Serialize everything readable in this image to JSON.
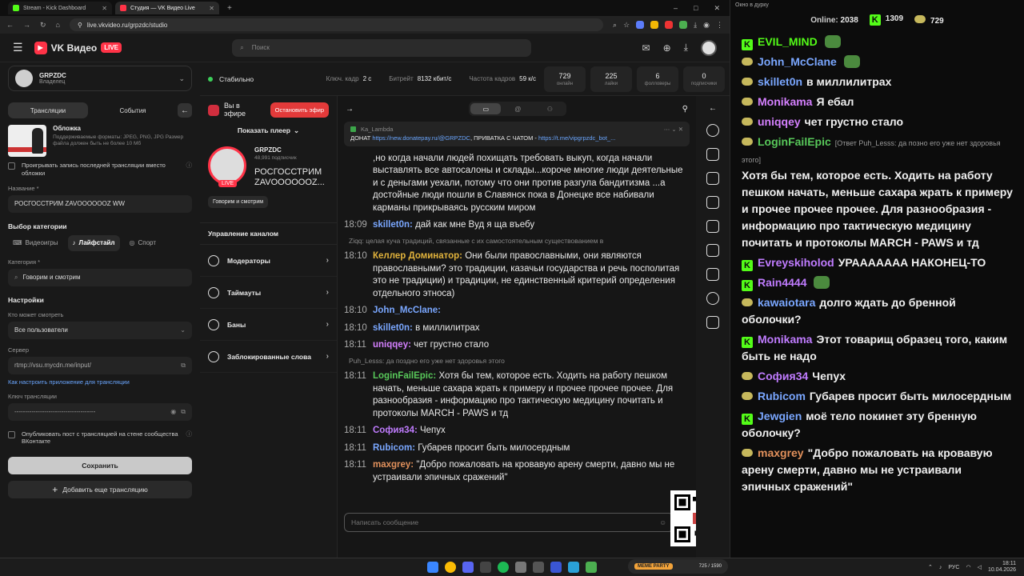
{
  "browser": {
    "tabs": [
      {
        "label": "Stream - Kick Dashboard",
        "active": false,
        "color": "#53fc18"
      },
      {
        "label": "Студия — VK Видео Live",
        "active": true,
        "color": "#ff3347"
      }
    ],
    "new_tab": "+",
    "url": "live.vkvideo.ru/grpzdc/studio"
  },
  "header": {
    "logo": "VK Видео",
    "live_badge": "LIVE",
    "search_placeholder": "Поиск"
  },
  "channel": {
    "name": "GRPZDC",
    "role": "Владелец"
  },
  "left": {
    "tab_streams": "Трансляции",
    "tab_events": "События",
    "cover_title": "Обложка",
    "cover_desc": "Поддерживаемые форматы: JPEG, PNG, JPG Размер файла должен быть не более 10 Мб",
    "replay_checkbox": "Проигрывать запись последней трансляции вместо обложки",
    "title_label": "Название *",
    "title_value": "РОСГОССТРИМ ZAVOOOOOOZ WW",
    "category_section": "Выбор категории",
    "cat_games": "Видеоигры",
    "cat_lifestyle": "Лайфстайл",
    "cat_sport": "Спорт",
    "category_label": "Категория *",
    "category_value": "Говорим и смотрим",
    "settings_section": "Настройки",
    "who_label": "Кто может смотреть",
    "who_value": "Все пользователи",
    "server_label": "Сервер",
    "server_value": "rtmp://vsu.mycdn.me/input/",
    "howto_link": "Как настроить приложение для трансляции",
    "key_label": "Ключ трансляции",
    "key_value": "--------------------------------------",
    "post_checkbox": "Опубликовать пост с трансляцией на стене сообщества ВКонтакте",
    "save_button": "Сохранить",
    "add_button": "Добавить еще трансляцию"
  },
  "stats": {
    "status": "Стабильно",
    "keyframe_label": "Ключ. кадр",
    "keyframe_value": "2 с",
    "bitrate_label": "Битрейт",
    "bitrate_value": "8132 кбит/с",
    "fps_label": "Частота кадров",
    "fps_value": "59 к/с",
    "online_value": "729",
    "online_label": "онлайн",
    "likes_value": "225",
    "likes_label": "лайки",
    "followers_value": "6",
    "followers_label": "фолловеры",
    "subs_value": "0",
    "subs_label": "подписчики"
  },
  "mid": {
    "on_air": "Вы в эфире",
    "stop_button": "Остановить эфир",
    "show_player": "Показать плеер",
    "streamer_name": "GRPZDC",
    "streamer_subs": "48,991 подписчик",
    "stream_title": "РОСГОССТРИМ ZAVOOOOOOZ...",
    "live_tag": "LIVE",
    "category_tag": "Говорим и смотрим",
    "manage_header": "Управление каналом",
    "manage_items": [
      "Модераторы",
      "Таймауты",
      "Баны",
      "Заблокированные слова"
    ]
  },
  "chat": {
    "pinned_author": "Ka_Lambda",
    "pinned_text": "ДОНАТ",
    "pinned_link1": "https://new.donatepay.ru/@GRPZDC",
    "pinned_mid": ", ПРИВАТКА С ЧАТОМ -",
    "pinned_link2": "https://t.me/vipgrpzdc_bot_...",
    "messages": [
      {
        "time": "",
        "name": "",
        "color": "#e8e8e8",
        "text": ",но когда начали людей похищать требовать выкуп, когда начали выставлять все автосалоны и склады...короче многие люди деятельные и с деньгами уехали, потому что они против разгула бандитизма ...а достойные люди пошли в Славянск пока в Донецке все набивали карманы прикрываясь русским миром",
        "reply": ""
      },
      {
        "time": "18:09",
        "name": "skillet0n:",
        "color": "#7aa7ff",
        "text": "дай как мне Вуд я ща въебу",
        "reply": ""
      },
      {
        "time": "18:10",
        "name": "Келлер Доминатор:",
        "color": "#e2b33c",
        "text": "Они были православными, они являются православными? это традиции, казачьи государства и речь посполитая это не традиции) и традиции, не единственный критерий определения отдельного этноса)",
        "reply": "Ziqq: целая куча традиций, связанные с их самостоятельным существованием в"
      },
      {
        "time": "18:10",
        "name": "John_McClane:",
        "color": "#7aa7ff",
        "text": "",
        "reply": ""
      },
      {
        "time": "18:10",
        "name": "skillet0n:",
        "color": "#7aa7ff",
        "text": "в миллилитрах",
        "reply": ""
      },
      {
        "time": "18:11",
        "name": "uniqqey:",
        "color": "#d580ff",
        "text": "чет грустно стало",
        "reply": ""
      },
      {
        "time": "18:11",
        "name": "LoginFailEpic:",
        "color": "#58c95a",
        "text": "Хотя бы тем, которое есть. Ходить на работу пешком начать, меньше сахара жрать к примеру и прочее прочее прочее. Для разнообразия - информацию про тактическую медицину почитать и протоколы MARCH - PAWS и тд",
        "reply": "Puh_Lesss: да поздно его уже нет здоровья этого"
      },
      {
        "time": "18:11",
        "name": "София34:",
        "color": "#c07cff",
        "text": "Чепух",
        "reply": ""
      },
      {
        "time": "18:11",
        "name": "Rubicom:",
        "color": "#7aa7ff",
        "text": "Губарев просит быть милосердным",
        "reply": ""
      },
      {
        "time": "18:11",
        "name": "maxgrey:",
        "color": "#e2915c",
        "text": "\"Добро пожаловать на кровавую арену смерти, давно мы не устраивали эпичных сражений\"",
        "reply": ""
      }
    ],
    "input_placeholder": "Написать сообщение"
  },
  "kick": {
    "window_title": "Окно в дурку",
    "online_label": "Online:",
    "online_value": "2038",
    "kick_count": "1309",
    "vk_count": "729",
    "messages": [
      {
        "badge": "k",
        "name": "EVIL_MIND",
        "color": "#53fc18",
        "text": "",
        "reply": ""
      },
      {
        "badge": "vk",
        "name": "John_McClane",
        "color": "#7aa7ff",
        "text": "",
        "reply": ""
      },
      {
        "badge": "vk",
        "name": "skillet0n",
        "color": "#7aa7ff",
        "text": "в миллилитрах",
        "reply": ""
      },
      {
        "badge": "vk",
        "name": "Monikama",
        "color": "#d580ff",
        "text": "Я ебал",
        "reply": ""
      },
      {
        "badge": "vk",
        "name": "uniqqey",
        "color": "#d580ff",
        "text": "чет грустно стало",
        "reply": ""
      },
      {
        "badge": "vk",
        "name": "LoginFailEpic",
        "color": "#58c95a",
        "text": "Хотя бы тем, которое есть. Ходить на работу пешком начать, меньше сахара жрать к примеру и прочее прочее прочее. Для разнообразия - информацию про тактическую медицину почитать и протоколы MARCH - PAWS и тд",
        "reply": "[Ответ Puh_Lesss: да позно его уже нет здоровья этого]"
      },
      {
        "badge": "k",
        "name": "Evreyskiholod",
        "color": "#c07cff",
        "text": "УРААААААА НАКОНЕЦ-ТО",
        "reply": ""
      },
      {
        "badge": "k",
        "name": "Rain4444",
        "color": "#c07cff",
        "text": "",
        "reply": ""
      },
      {
        "badge": "vk",
        "name": "kawaiotara",
        "color": "#7aa7ff",
        "text": "долго ждать до бренной оболочки?",
        "reply": ""
      },
      {
        "badge": "k",
        "name": "Monikama",
        "color": "#c07cff",
        "text": "Этот товарищ образец того, каким быть не надо",
        "reply": ""
      },
      {
        "badge": "vk",
        "name": "София34",
        "color": "#c07cff",
        "text": "Чепух",
        "reply": ""
      },
      {
        "badge": "vk",
        "name": "Rubicom",
        "color": "#7aa7ff",
        "text": "Губарев просит быть милосердным",
        "reply": ""
      },
      {
        "badge": "k",
        "name": "Jewgien",
        "color": "#7aa7ff",
        "text": "моё тело покинет эту бренную оболочку?",
        "reply": ""
      },
      {
        "badge": "vk",
        "name": "maxgrey",
        "color": "#e2915c",
        "text": "\"Добро пожаловать на кровавую арену смерти, давно мы не устраивали эпичных сражений\"",
        "reply": ""
      }
    ]
  },
  "taskbar": {
    "lang": "РУС",
    "time": "18:11",
    "date": "10.04.2026",
    "meme_label": "MEME PARTY",
    "meme_count": "725 / 1590"
  }
}
